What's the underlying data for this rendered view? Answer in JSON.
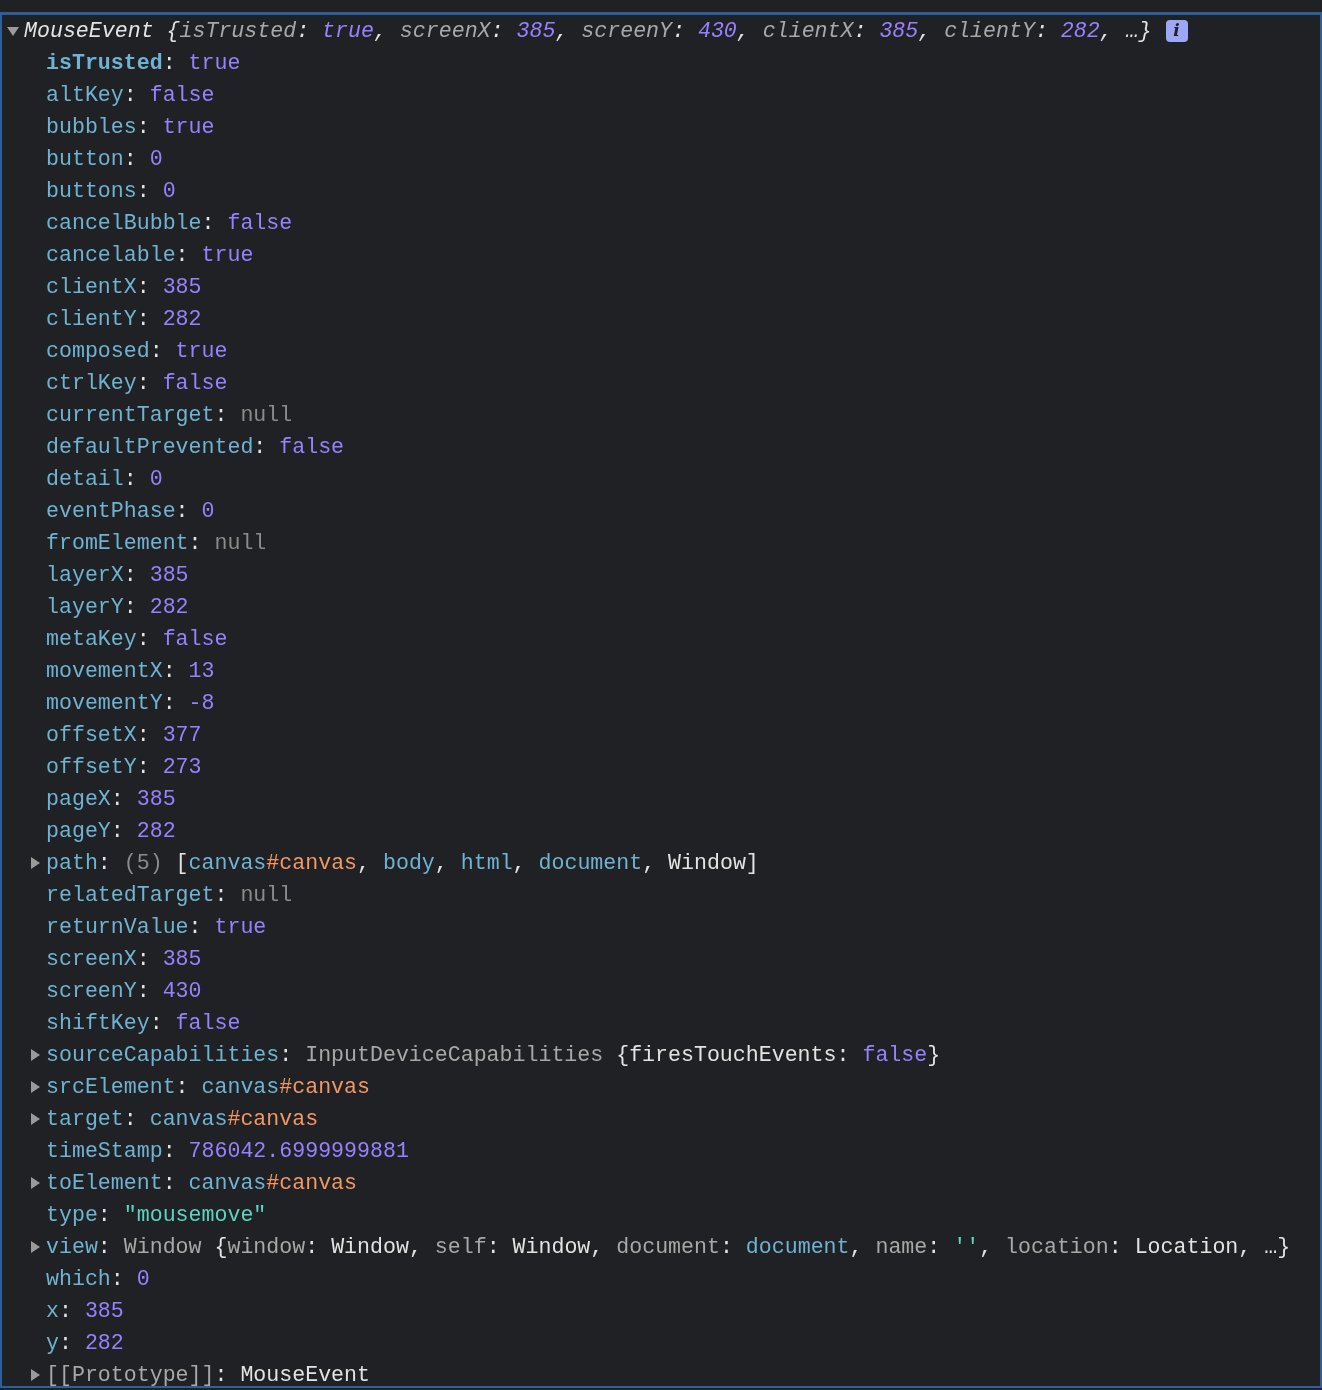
{
  "summary": {
    "expanded": true,
    "info_badge": "i",
    "tokens": [
      {
        "kind": "plain",
        "text": "MouseEvent {"
      },
      {
        "kind": "pkey",
        "text": "isTrusted"
      },
      {
        "kind": "punct",
        "text": ": "
      },
      {
        "kind": "bool",
        "text": "true"
      },
      {
        "kind": "punct",
        "text": ", "
      },
      {
        "kind": "pkey",
        "text": "screenX"
      },
      {
        "kind": "punct",
        "text": ": "
      },
      {
        "kind": "number",
        "text": "385"
      },
      {
        "kind": "punct",
        "text": ", "
      },
      {
        "kind": "pkey",
        "text": "screenY"
      },
      {
        "kind": "punct",
        "text": ": "
      },
      {
        "kind": "number",
        "text": "430"
      },
      {
        "kind": "punct",
        "text": ", "
      },
      {
        "kind": "pkey",
        "text": "clientX"
      },
      {
        "kind": "punct",
        "text": ": "
      },
      {
        "kind": "number",
        "text": "385"
      },
      {
        "kind": "punct",
        "text": ", "
      },
      {
        "kind": "pkey",
        "text": "clientY"
      },
      {
        "kind": "punct",
        "text": ": "
      },
      {
        "kind": "number",
        "text": "282"
      },
      {
        "kind": "punct",
        "text": ", …}"
      }
    ]
  },
  "properties": [
    {
      "tokens": [
        {
          "kind": "ownkey",
          "text": "isTrusted"
        },
        {
          "kind": "punct",
          "text": ": "
        },
        {
          "kind": "bool",
          "text": "true"
        }
      ]
    },
    {
      "tokens": [
        {
          "kind": "key",
          "text": "altKey"
        },
        {
          "kind": "punct",
          "text": ": "
        },
        {
          "kind": "bool",
          "text": "false"
        }
      ]
    },
    {
      "tokens": [
        {
          "kind": "key",
          "text": "bubbles"
        },
        {
          "kind": "punct",
          "text": ": "
        },
        {
          "kind": "bool",
          "text": "true"
        }
      ]
    },
    {
      "tokens": [
        {
          "kind": "key",
          "text": "button"
        },
        {
          "kind": "punct",
          "text": ": "
        },
        {
          "kind": "number",
          "text": "0"
        }
      ]
    },
    {
      "tokens": [
        {
          "kind": "key",
          "text": "buttons"
        },
        {
          "kind": "punct",
          "text": ": "
        },
        {
          "kind": "number",
          "text": "0"
        }
      ]
    },
    {
      "tokens": [
        {
          "kind": "key",
          "text": "cancelBubble"
        },
        {
          "kind": "punct",
          "text": ": "
        },
        {
          "kind": "bool",
          "text": "false"
        }
      ]
    },
    {
      "tokens": [
        {
          "kind": "key",
          "text": "cancelable"
        },
        {
          "kind": "punct",
          "text": ": "
        },
        {
          "kind": "bool",
          "text": "true"
        }
      ]
    },
    {
      "tokens": [
        {
          "kind": "key",
          "text": "clientX"
        },
        {
          "kind": "punct",
          "text": ": "
        },
        {
          "kind": "number",
          "text": "385"
        }
      ]
    },
    {
      "tokens": [
        {
          "kind": "key",
          "text": "clientY"
        },
        {
          "kind": "punct",
          "text": ": "
        },
        {
          "kind": "number",
          "text": "282"
        }
      ]
    },
    {
      "tokens": [
        {
          "kind": "key",
          "text": "composed"
        },
        {
          "kind": "punct",
          "text": ": "
        },
        {
          "kind": "bool",
          "text": "true"
        }
      ]
    },
    {
      "tokens": [
        {
          "kind": "key",
          "text": "ctrlKey"
        },
        {
          "kind": "punct",
          "text": ": "
        },
        {
          "kind": "bool",
          "text": "false"
        }
      ]
    },
    {
      "tokens": [
        {
          "kind": "key",
          "text": "currentTarget"
        },
        {
          "kind": "punct",
          "text": ": "
        },
        {
          "kind": "null",
          "text": "null"
        }
      ]
    },
    {
      "tokens": [
        {
          "kind": "key",
          "text": "defaultPrevented"
        },
        {
          "kind": "punct",
          "text": ": "
        },
        {
          "kind": "bool",
          "text": "false"
        }
      ]
    },
    {
      "tokens": [
        {
          "kind": "key",
          "text": "detail"
        },
        {
          "kind": "punct",
          "text": ": "
        },
        {
          "kind": "number",
          "text": "0"
        }
      ]
    },
    {
      "tokens": [
        {
          "kind": "key",
          "text": "eventPhase"
        },
        {
          "kind": "punct",
          "text": ": "
        },
        {
          "kind": "number",
          "text": "0"
        }
      ]
    },
    {
      "tokens": [
        {
          "kind": "key",
          "text": "fromElement"
        },
        {
          "kind": "punct",
          "text": ": "
        },
        {
          "kind": "null",
          "text": "null"
        }
      ]
    },
    {
      "tokens": [
        {
          "kind": "key",
          "text": "layerX"
        },
        {
          "kind": "punct",
          "text": ": "
        },
        {
          "kind": "number",
          "text": "385"
        }
      ]
    },
    {
      "tokens": [
        {
          "kind": "key",
          "text": "layerY"
        },
        {
          "kind": "punct",
          "text": ": "
        },
        {
          "kind": "number",
          "text": "282"
        }
      ]
    },
    {
      "tokens": [
        {
          "kind": "key",
          "text": "metaKey"
        },
        {
          "kind": "punct",
          "text": ": "
        },
        {
          "kind": "bool",
          "text": "false"
        }
      ]
    },
    {
      "tokens": [
        {
          "kind": "key",
          "text": "movementX"
        },
        {
          "kind": "punct",
          "text": ": "
        },
        {
          "kind": "number",
          "text": "13"
        }
      ]
    },
    {
      "tokens": [
        {
          "kind": "key",
          "text": "movementY"
        },
        {
          "kind": "punct",
          "text": ": "
        },
        {
          "kind": "number",
          "text": "-8"
        }
      ]
    },
    {
      "tokens": [
        {
          "kind": "key",
          "text": "offsetX"
        },
        {
          "kind": "punct",
          "text": ": "
        },
        {
          "kind": "number",
          "text": "377"
        }
      ]
    },
    {
      "tokens": [
        {
          "kind": "key",
          "text": "offsetY"
        },
        {
          "kind": "punct",
          "text": ": "
        },
        {
          "kind": "number",
          "text": "273"
        }
      ]
    },
    {
      "tokens": [
        {
          "kind": "key",
          "text": "pageX"
        },
        {
          "kind": "punct",
          "text": ": "
        },
        {
          "kind": "number",
          "text": "385"
        }
      ]
    },
    {
      "tokens": [
        {
          "kind": "key",
          "text": "pageY"
        },
        {
          "kind": "punct",
          "text": ": "
        },
        {
          "kind": "number",
          "text": "282"
        }
      ]
    },
    {
      "expanded": false,
      "tokens": [
        {
          "kind": "key",
          "text": "path"
        },
        {
          "kind": "punct",
          "text": ": "
        },
        {
          "kind": "null",
          "text": "(5) "
        },
        {
          "kind": "plain",
          "text": "["
        },
        {
          "kind": "tag",
          "text": "canvas"
        },
        {
          "kind": "id",
          "text": "#canvas"
        },
        {
          "kind": "plain",
          "text": ", "
        },
        {
          "kind": "tag",
          "text": "body"
        },
        {
          "kind": "plain",
          "text": ", "
        },
        {
          "kind": "tag",
          "text": "html"
        },
        {
          "kind": "plain",
          "text": ", "
        },
        {
          "kind": "tag",
          "text": "document"
        },
        {
          "kind": "plain",
          "text": ", Window]"
        }
      ]
    },
    {
      "tokens": [
        {
          "kind": "key",
          "text": "relatedTarget"
        },
        {
          "kind": "punct",
          "text": ": "
        },
        {
          "kind": "null",
          "text": "null"
        }
      ]
    },
    {
      "tokens": [
        {
          "kind": "key",
          "text": "returnValue"
        },
        {
          "kind": "punct",
          "text": ": "
        },
        {
          "kind": "bool",
          "text": "true"
        }
      ]
    },
    {
      "tokens": [
        {
          "kind": "key",
          "text": "screenX"
        },
        {
          "kind": "punct",
          "text": ": "
        },
        {
          "kind": "number",
          "text": "385"
        }
      ]
    },
    {
      "tokens": [
        {
          "kind": "key",
          "text": "screenY"
        },
        {
          "kind": "punct",
          "text": ": "
        },
        {
          "kind": "number",
          "text": "430"
        }
      ]
    },
    {
      "tokens": [
        {
          "kind": "key",
          "text": "shiftKey"
        },
        {
          "kind": "punct",
          "text": ": "
        },
        {
          "kind": "bool",
          "text": "false"
        }
      ]
    },
    {
      "expanded": false,
      "tokens": [
        {
          "kind": "key",
          "text": "sourceCapabilities"
        },
        {
          "kind": "punct",
          "text": ": "
        },
        {
          "kind": "class",
          "text": "InputDeviceCapabilities "
        },
        {
          "kind": "plain",
          "text": "{firesTouchEvents: "
        },
        {
          "kind": "bool",
          "text": "false"
        },
        {
          "kind": "plain",
          "text": "}"
        }
      ]
    },
    {
      "expanded": false,
      "tokens": [
        {
          "kind": "key",
          "text": "srcElement"
        },
        {
          "kind": "punct",
          "text": ": "
        },
        {
          "kind": "tag",
          "text": "canvas"
        },
        {
          "kind": "id",
          "text": "#canvas"
        }
      ]
    },
    {
      "expanded": false,
      "tokens": [
        {
          "kind": "key",
          "text": "target"
        },
        {
          "kind": "punct",
          "text": ": "
        },
        {
          "kind": "tag",
          "text": "canvas"
        },
        {
          "kind": "id",
          "text": "#canvas"
        }
      ]
    },
    {
      "tokens": [
        {
          "kind": "key",
          "text": "timeStamp"
        },
        {
          "kind": "punct",
          "text": ": "
        },
        {
          "kind": "number",
          "text": "786042.6999999881"
        }
      ]
    },
    {
      "expanded": false,
      "tokens": [
        {
          "kind": "key",
          "text": "toElement"
        },
        {
          "kind": "punct",
          "text": ": "
        },
        {
          "kind": "tag",
          "text": "canvas"
        },
        {
          "kind": "id",
          "text": "#canvas"
        }
      ]
    },
    {
      "tokens": [
        {
          "kind": "key",
          "text": "type"
        },
        {
          "kind": "punct",
          "text": ": "
        },
        {
          "kind": "string",
          "text": "\"mousemove\""
        }
      ]
    },
    {
      "expanded": false,
      "tokens": [
        {
          "kind": "key",
          "text": "view"
        },
        {
          "kind": "punct",
          "text": ": "
        },
        {
          "kind": "class",
          "text": "Window "
        },
        {
          "kind": "plain",
          "text": "{"
        },
        {
          "kind": "pkey",
          "text": "window"
        },
        {
          "kind": "plain",
          "text": ": Window, "
        },
        {
          "kind": "pkey",
          "text": "self"
        },
        {
          "kind": "plain",
          "text": ": Window, "
        },
        {
          "kind": "pkey",
          "text": "document"
        },
        {
          "kind": "plain",
          "text": ": "
        },
        {
          "kind": "tag",
          "text": "document"
        },
        {
          "kind": "plain",
          "text": ", "
        },
        {
          "kind": "pkey",
          "text": "name"
        },
        {
          "kind": "plain",
          "text": ": "
        },
        {
          "kind": "string",
          "text": "''"
        },
        {
          "kind": "plain",
          "text": ", "
        },
        {
          "kind": "pkey",
          "text": "location"
        },
        {
          "kind": "plain",
          "text": ": Location, …}"
        }
      ]
    },
    {
      "tokens": [
        {
          "kind": "key",
          "text": "which"
        },
        {
          "kind": "punct",
          "text": ": "
        },
        {
          "kind": "number",
          "text": "0"
        }
      ]
    },
    {
      "tokens": [
        {
          "kind": "key",
          "text": "x"
        },
        {
          "kind": "punct",
          "text": ": "
        },
        {
          "kind": "number",
          "text": "385"
        }
      ]
    },
    {
      "tokens": [
        {
          "kind": "key",
          "text": "y"
        },
        {
          "kind": "punct",
          "text": ": "
        },
        {
          "kind": "number",
          "text": "282"
        }
      ]
    },
    {
      "expanded": false,
      "tokens": [
        {
          "kind": "class2",
          "text": "[[Prototype]]"
        },
        {
          "kind": "punct",
          "text": ": "
        },
        {
          "kind": "plain",
          "text": "MouseEvent"
        }
      ]
    }
  ]
}
